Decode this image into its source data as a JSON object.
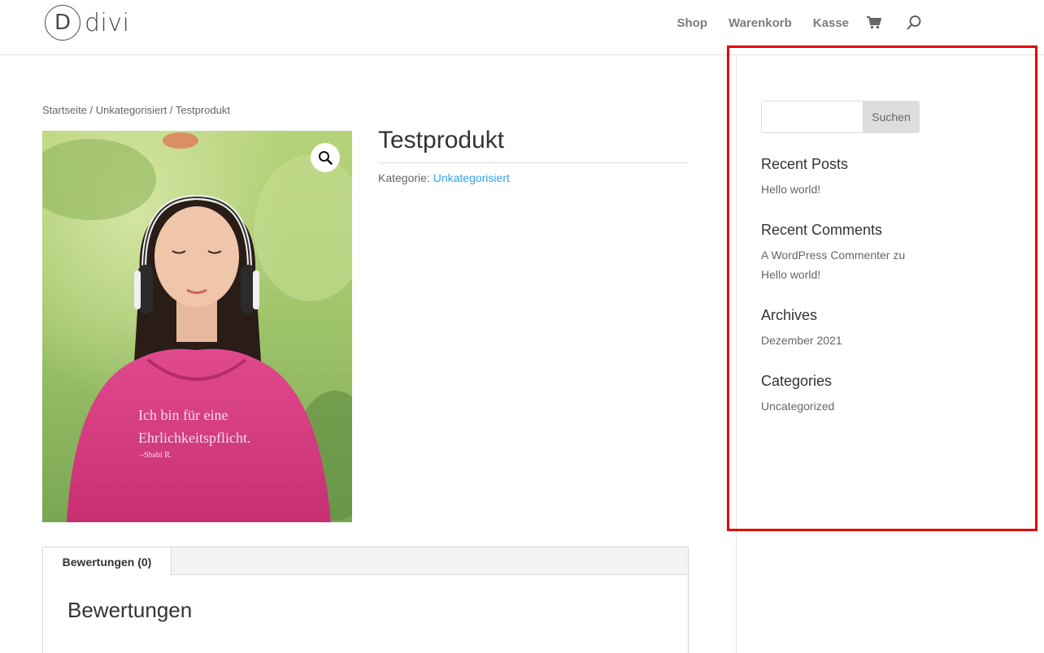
{
  "header": {
    "logo_letter": "D",
    "logo_text": "divi",
    "nav": [
      "Shop",
      "Warenkorb",
      "Kasse"
    ],
    "cart_icon": "cart-icon",
    "search_icon": "search-icon"
  },
  "breadcrumb": {
    "home": "Startseite",
    "sep": " / ",
    "category": "Unkategorisiert",
    "current": "Testprodukt"
  },
  "product": {
    "title": "Testprodukt",
    "category_label": "Kategorie: ",
    "category_link": "Unkategorisiert",
    "image_quote_line1": "Ich bin für eine",
    "image_quote_line2": "Ehrlichkeitspflicht.",
    "image_quote_author": "–Shabi R.",
    "zoom_icon": "magnifier-icon"
  },
  "tabs": {
    "active_tab": "Bewertungen (0)",
    "panel_title": "Bewertungen"
  },
  "sidebar": {
    "search_placeholder": "",
    "search_button": "Suchen",
    "recent_posts_title": "Recent Posts",
    "recent_posts": [
      "Hello world!"
    ],
    "recent_comments_title": "Recent Comments",
    "recent_comments": [
      {
        "author": "A WordPress Commenter",
        "connector": " zu ",
        "post": "Hello world!"
      }
    ],
    "archives_title": "Archives",
    "archives": [
      "Dezember 2021"
    ],
    "categories_title": "Categories",
    "categories": [
      "Uncategorized"
    ]
  },
  "colors": {
    "accent": "#2ea3f2",
    "highlight": "#e60000",
    "hoodie": "#d63a82"
  }
}
